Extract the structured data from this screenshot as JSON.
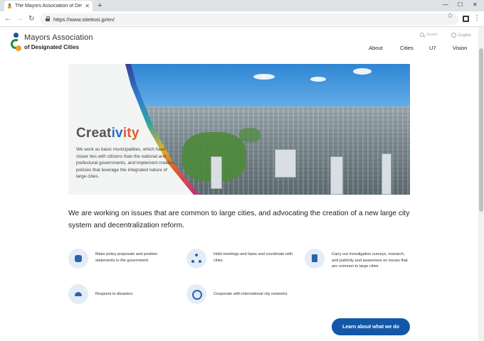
{
  "browser": {
    "tab_title": "The Mayors Association of Desig",
    "url": "https://www.siteitosi.jp/en/"
  },
  "header": {
    "brand_line1": "Mayors Association",
    "brand_line2": "of Designated Cities",
    "search_placeholder": "Seach",
    "language": "English",
    "nav": [
      "About",
      "Cities",
      "U7",
      "Vision"
    ]
  },
  "hero": {
    "title_parts": [
      "Creat",
      "iv",
      "ity"
    ],
    "text": "We work as basic municipalities, which have closer ties with citizens than the national and prefectural governments, and implement creative policies that leverage the integrated nature of large cities."
  },
  "headline": "We are working on issues that are common to large cities, and advocating the creation of a new large city system and decentralization reform.",
  "features": [
    {
      "icon": "speech-bubble-icon",
      "text": "Make policy proposals and position statements to the government"
    },
    {
      "icon": "network-nodes-icon",
      "text": "Hold meetings and liaise and coordinate with cities"
    },
    {
      "icon": "document-pen-icon",
      "text": "Carry out investigative surveys, research, and publicity and awareness on issues that are common to large cities"
    },
    {
      "icon": "helmet-icon",
      "text": "Respond to disasters"
    },
    {
      "icon": "globe-network-icon",
      "text": "Cooperate with international city networks"
    }
  ],
  "cta_label": "Learn about what we do",
  "colors": {
    "primary": "#1357a8",
    "icon_bg": "#e4edf6"
  }
}
